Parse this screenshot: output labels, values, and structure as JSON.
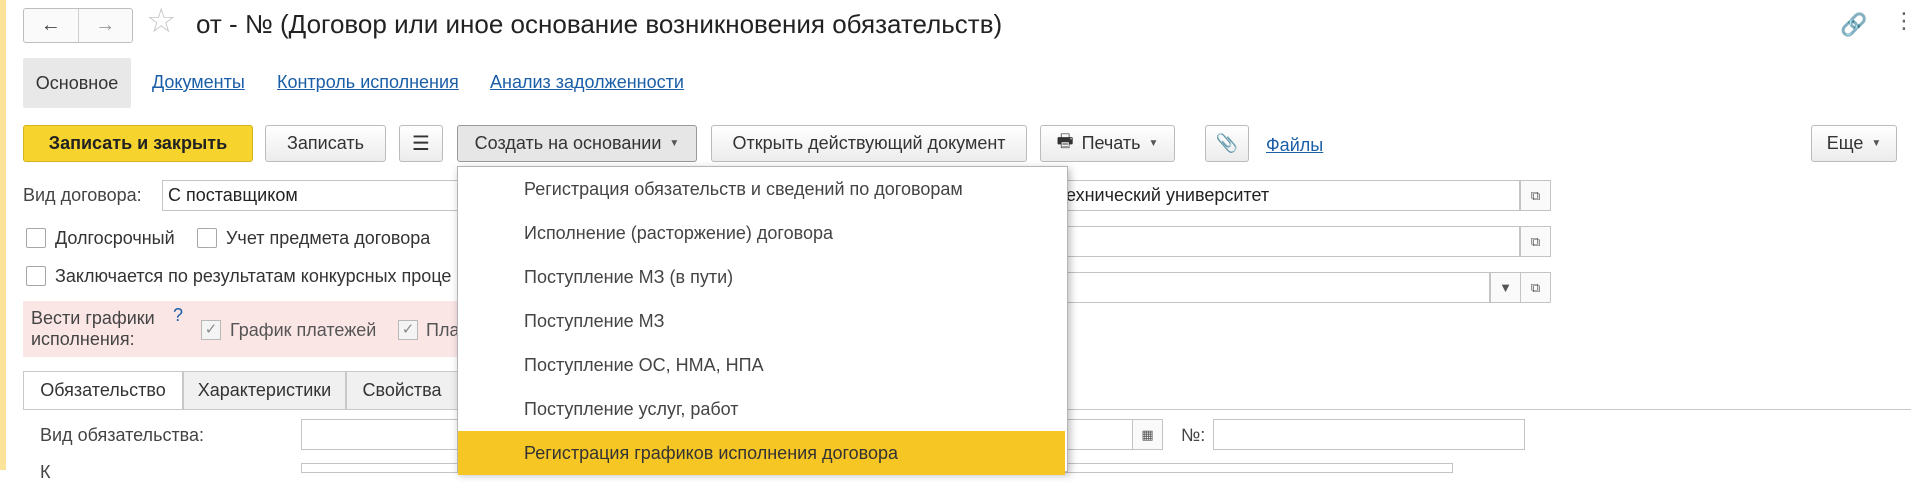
{
  "header": {
    "back_icon": "←",
    "forward_icon": "→",
    "star_icon": "☆",
    "title": "от - № (Договор или иное основание возникновения обязательств)",
    "link_icon": "🔗",
    "more_icon": "⋮"
  },
  "sections": {
    "active": "Основное",
    "links": [
      "Документы",
      "Контроль исполнения",
      "Анализ задолженности"
    ]
  },
  "toolbar": {
    "save_close": "Записать и закрыть",
    "save": "Записать",
    "report_icon": "☰",
    "create_based": "Создать на основании",
    "open_current": "Открыть действующий документ",
    "print_icon": "🖶",
    "print": "Печать",
    "attach_icon": "📎",
    "files": "Файлы",
    "more": "Еще"
  },
  "form": {
    "contract_type_label": "Вид договора:",
    "contract_type_value": "С поставщиком",
    "org_value_fragment": "ехнический университет",
    "long_term_label": "Долгосрочный",
    "subject_label": "Учет предмета договора",
    "tender_label": "Заключается по результатам конкурсных проце",
    "schedules_label_1": "Вести графики",
    "schedules_label_2": "исполнения:",
    "help_mark": "?",
    "payments_schedule_label": "График платежей",
    "plan_fragment": "Пла",
    "obligation_type_label": "Вид обязательства:",
    "number_label": "№:",
    "next_row_label_fragment": "К"
  },
  "tabs": [
    "Обязательство",
    "Характеристики",
    "Свойства"
  ],
  "dropdown": {
    "items": [
      "Регистрация обязательств и сведений по договорам",
      "Исполнение (расторжение) договора",
      "Поступление МЗ (в пути)",
      "Поступление МЗ",
      "Поступление ОС, НМА, НПА",
      "Поступление услуг, работ",
      "Регистрация графиков исполнения договора"
    ],
    "selected_index": 6
  },
  "colors": {
    "primary_button": "#f6d32d",
    "link": "#1a5ea8",
    "selected_menu_item": "#f6c624",
    "schedules_panel": "#fbe6e6"
  }
}
